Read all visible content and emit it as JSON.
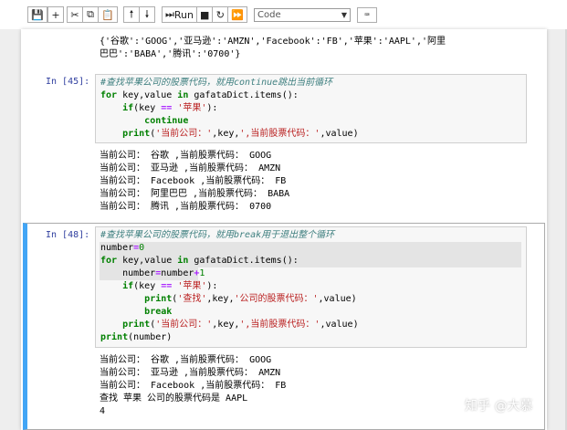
{
  "toolbar": {
    "buttons": [
      "save",
      "add-cell",
      "cut",
      "copy",
      "paste",
      "move-up",
      "move-down",
      "run",
      "interrupt",
      "restart",
      "restart-run-all"
    ],
    "run_label": "Run",
    "cell_type": "Code"
  },
  "cell0": {
    "output_lines": [
      "{'谷歌':'GOOG','亚马逊':'AMZN','Facebook':'FB','苹果':'AAPL','阿里",
      "巴巴':'BABA','腾讯':'0700'}"
    ]
  },
  "cell1": {
    "prompt": "In [45]:",
    "code_lines": [
      "#查找苹果公司的股票代码，就用continue跳出当前循环",
      "for key,value in gafataDict.items():",
      "    if(key == '苹果'):",
      "        continue",
      "    print('当前公司：',key,',当前股票代码：',value)"
    ],
    "output_lines": [
      "当前公司： 谷歌 ,当前股票代码： GOOG",
      "当前公司： 亚马逊 ,当前股票代码： AMZN",
      "当前公司： Facebook ,当前股票代码： FB",
      "当前公司： 阿里巴巴 ,当前股票代码： BABA",
      "当前公司： 腾讯 ,当前股票代码： 0700"
    ]
  },
  "cell2": {
    "prompt": "In [48]:",
    "code_lines": [
      "#查找苹果公司的股票代码，就用break用于退出整个循环",
      "number=0",
      "for key,value in gafataDict.items():",
      "    number=number+1",
      "    if(key == '苹果'):",
      "        print('查找',key,'公司的股票代码：',value)",
      "        break",
      "    print('当前公司：',key,',当前股票代码：',value)",
      "print(number)"
    ],
    "output_lines": [
      "当前公司： 谷歌 ,当前股票代码： GOOG",
      "当前公司： 亚马逊 ,当前股票代码： AMZN",
      "当前公司： Facebook ,当前股票代码： FB",
      "查找 苹果 公司的股票代码是 AAPL",
      "4"
    ]
  },
  "watermark": "知乎 @大慕",
  "colors": {
    "prompt": "#303f9f",
    "keyword": "#008000",
    "string": "#ba2121",
    "comment": "#408080",
    "selected_border": "#42a5f5"
  }
}
